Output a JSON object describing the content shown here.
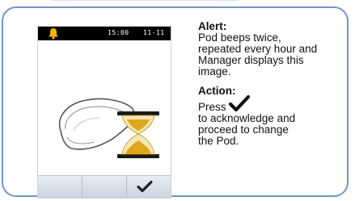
{
  "device": {
    "status_value_1": "15:00",
    "status_value_2": "11-11",
    "icons": {
      "status": "bell-icon",
      "image": "pod-with-hourglass-icon",
      "softkey": "checkmark-icon"
    }
  },
  "instructions": {
    "alert_heading": "Alert:",
    "alert_lines": [
      "Pod beeps twice,",
      "repeated every hour and",
      "Manager displays this",
      "image."
    ],
    "action_heading": "Action:",
    "action_press": "Press",
    "action_lines": [
      "to acknowledge and",
      "proceed to change",
      "the Pod."
    ]
  },
  "colors": {
    "card_border": "#6f97c8",
    "bell": "#f2b705",
    "hourglass": "#e0a61a"
  }
}
